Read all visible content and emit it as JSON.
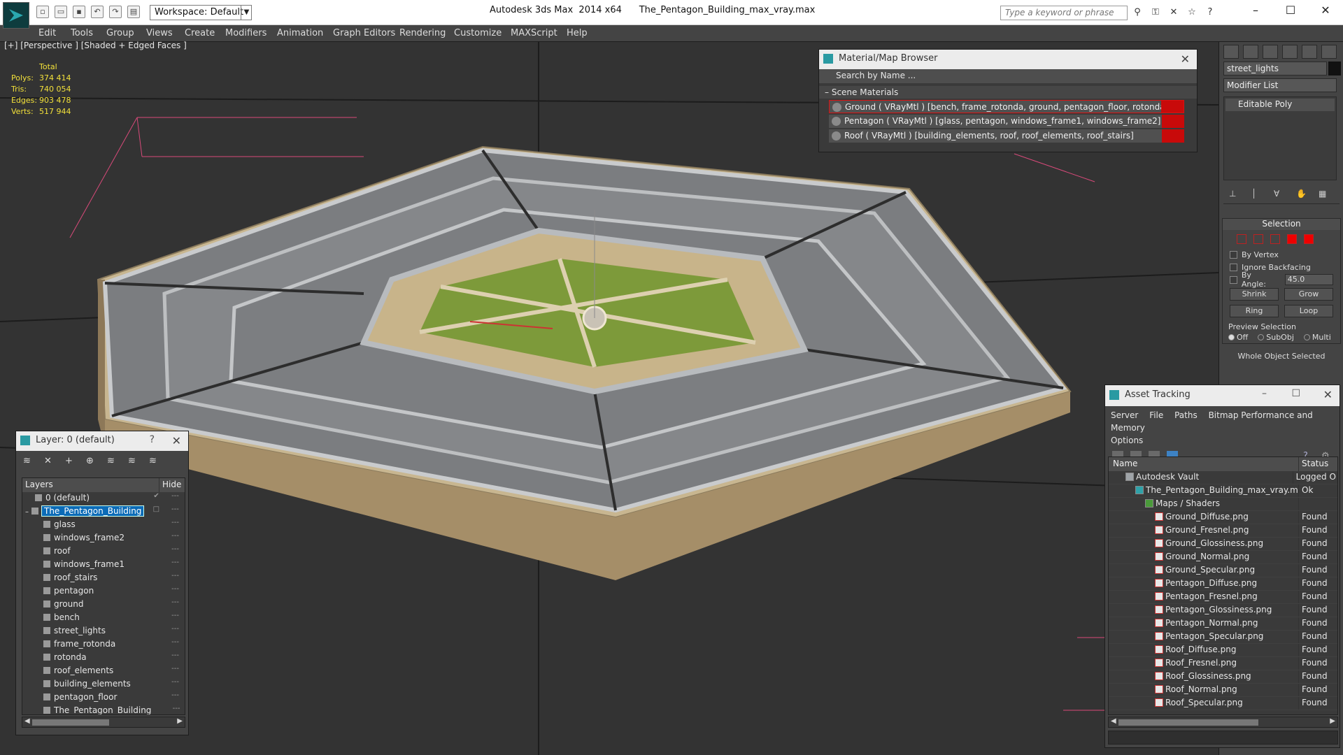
{
  "app": {
    "title": "Autodesk 3ds Max  2014 x64",
    "file": "The_Pentagon_Building_max_vray.max",
    "workspace": "Workspace: Default",
    "search_placeholder": "Type a keyword or phrase"
  },
  "menu": [
    "Edit",
    "Tools",
    "Group",
    "Views",
    "Create",
    "Modifiers",
    "Animation",
    "Graph Editors",
    "Rendering",
    "Customize",
    "MAXScript",
    "Help"
  ],
  "viewport": {
    "label": "[+] [Perspective ] [Shaded + Edged Faces ]",
    "stats": {
      "header": "Total",
      "rows": [
        {
          "k": "Polys:",
          "v": "374 414"
        },
        {
          "k": "Tris:",
          "v": "740 054"
        },
        {
          "k": "Edges:",
          "v": "903 478"
        },
        {
          "k": "Verts:",
          "v": "517 944"
        }
      ]
    }
  },
  "material_browser": {
    "title": "Material/Map Browser",
    "search": "Search by Name ...",
    "group": "Scene Materials",
    "rows": [
      "Ground  ( VRayMtl ) [bench, frame_rotonda, ground, pentagon_floor, rotonda, street_lights]",
      "Pentagon  ( VRayMtl ) [glass, pentagon, windows_frame1, windows_frame2]",
      "Roof  ( VRayMtl ) [building_elements, roof, roof_elements, roof_stairs]"
    ]
  },
  "command_panel": {
    "object_name": "street_lights",
    "modifier_list": "Modifier List",
    "stack_item": "Editable Poly",
    "selection_title": "Selection",
    "by_vertex": "By Vertex",
    "ignore_backfacing": "Ignore Backfacing",
    "by_angle": "By Angle:",
    "angle_value": "45.0",
    "shrink": "Shrink",
    "grow": "Grow",
    "ring": "Ring",
    "loop": "Loop",
    "preview_selection": "Preview Selection",
    "off": "Off",
    "subobj": "SubObj",
    "multi": "Multi",
    "whole_object": "Whole Object Selected"
  },
  "layers": {
    "title": "Layer: 0 (default)",
    "help": "?",
    "col_layers": "Layers",
    "col_hide": "Hide",
    "rows": [
      {
        "name": "0 (default)"
      },
      {
        "name": "The_Pentagon_Building"
      },
      {
        "name": "glass"
      },
      {
        "name": "windows_frame2"
      },
      {
        "name": "roof"
      },
      {
        "name": "windows_frame1"
      },
      {
        "name": "roof_stairs"
      },
      {
        "name": "pentagon"
      },
      {
        "name": "ground"
      },
      {
        "name": "bench"
      },
      {
        "name": "street_lights"
      },
      {
        "name": "frame_rotonda"
      },
      {
        "name": "rotonda"
      },
      {
        "name": "roof_elements"
      },
      {
        "name": "building_elements"
      },
      {
        "name": "pentagon_floor"
      },
      {
        "name": "The_Pentagon_Building"
      }
    ]
  },
  "asset_tracking": {
    "title": "Asset Tracking",
    "menu": [
      "Server",
      "File",
      "Paths",
      "Bitmap Performance and Memory",
      "Options"
    ],
    "col_name": "Name",
    "col_status": "Status",
    "rows": [
      {
        "name": "Autodesk Vault",
        "status": "Logged O"
      },
      {
        "name": "The_Pentagon_Building_max_vray.max",
        "status": "Ok"
      },
      {
        "name": "Maps / Shaders",
        "status": ""
      },
      {
        "name": "Ground_Diffuse.png",
        "status": "Found"
      },
      {
        "name": "Ground_Fresnel.png",
        "status": "Found"
      },
      {
        "name": "Ground_Glossiness.png",
        "status": "Found"
      },
      {
        "name": "Ground_Normal.png",
        "status": "Found"
      },
      {
        "name": "Ground_Specular.png",
        "status": "Found"
      },
      {
        "name": "Pentagon_Diffuse.png",
        "status": "Found"
      },
      {
        "name": "Pentagon_Fresnel.png",
        "status": "Found"
      },
      {
        "name": "Pentagon_Glossiness.png",
        "status": "Found"
      },
      {
        "name": "Pentagon_Normal.png",
        "status": "Found"
      },
      {
        "name": "Pentagon_Specular.png",
        "status": "Found"
      },
      {
        "name": "Roof_Diffuse.png",
        "status": "Found"
      },
      {
        "name": "Roof_Fresnel.png",
        "status": "Found"
      },
      {
        "name": "Roof_Glossiness.png",
        "status": "Found"
      },
      {
        "name": "Roof_Normal.png",
        "status": "Found"
      },
      {
        "name": "Roof_Specular.png",
        "status": "Found"
      }
    ]
  },
  "colors": {
    "viewport_bg": "#333333",
    "panel_bg": "#444444",
    "stats_yellow": "#f2e03a",
    "selection_blue": "#0b6bb7",
    "material_red": "#c80a0a"
  }
}
